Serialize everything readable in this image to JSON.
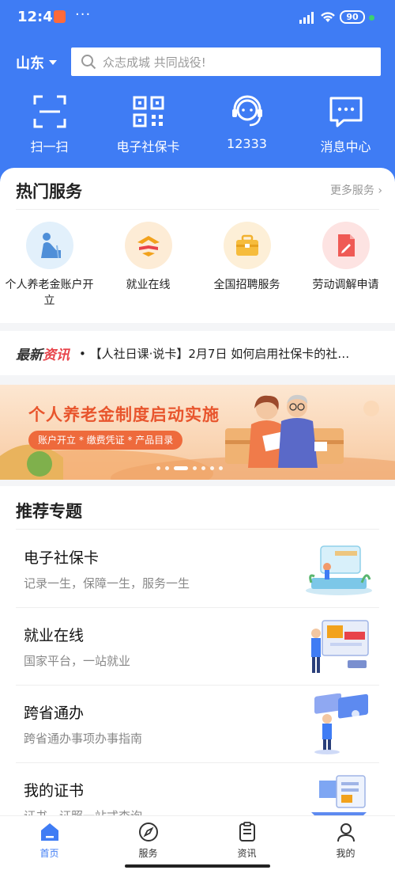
{
  "status": {
    "time": "12:43",
    "battery": "90"
  },
  "header": {
    "city": "山东",
    "search_placeholder": "众志成城 共同战役!",
    "quick": [
      {
        "label": "扫一扫",
        "icon": "scan-icon"
      },
      {
        "label": "电子社保卡",
        "icon": "qrcode-icon"
      },
      {
        "label": "12333",
        "icon": "headset-icon"
      },
      {
        "label": "消息中心",
        "icon": "message-icon"
      }
    ]
  },
  "hot": {
    "title": "热门服务",
    "more": "更多服务 ›",
    "items": [
      {
        "label": "个人养老金账户开立",
        "icon": "pension-icon"
      },
      {
        "label": "就业在线",
        "icon": "employment-icon"
      },
      {
        "label": "全国招聘服务",
        "icon": "briefcase-icon"
      },
      {
        "label": "劳动调解申请",
        "icon": "document-icon"
      }
    ]
  },
  "news": {
    "tag_a": "最新",
    "tag_b": "资讯",
    "text": "• 【人社日课·说卡】2月7日 如何启用社保卡的社…"
  },
  "banner": {
    "title": "个人养老金制度启动实施",
    "subtitle": "账户开立 * 缴费凭证 * 产品目录"
  },
  "recommend": {
    "title": "推荐专题",
    "items": [
      {
        "title": "电子社保卡",
        "desc": "记录一生，保障一生，服务一生"
      },
      {
        "title": "就业在线",
        "desc": "国家平台，一站就业"
      },
      {
        "title": "跨省通办",
        "desc": "跨省通办事项办事指南"
      },
      {
        "title": "我的证书",
        "desc": "证书，证照一站式查询"
      }
    ]
  },
  "nav": {
    "items": [
      {
        "label": "首页"
      },
      {
        "label": "服务"
      },
      {
        "label": "资讯"
      },
      {
        "label": "我的"
      }
    ]
  },
  "colors": {
    "brand": "#3f7cf4",
    "accent": "#e8434a"
  }
}
